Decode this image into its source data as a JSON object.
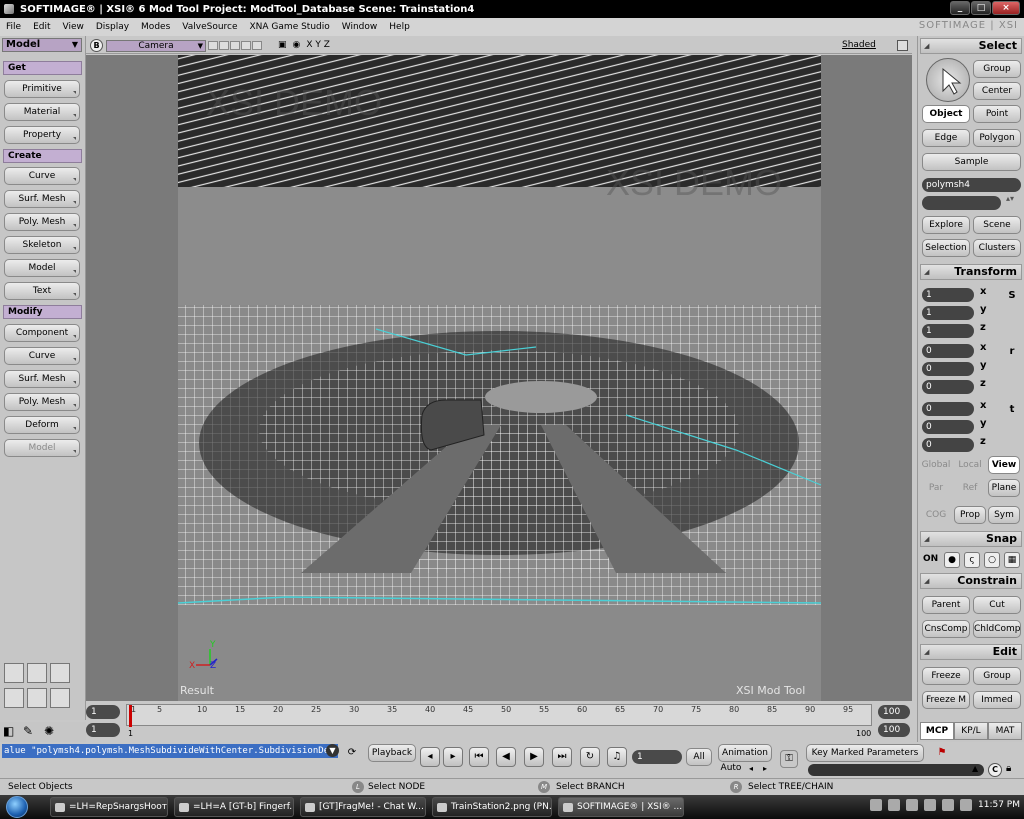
{
  "window": {
    "title": "SOFTIMAGE® | XSI® 6 Mod Tool Project: ModTool_Database    Scene: Trainstation4",
    "brand": "SOFTIMAGE | XSI"
  },
  "menubar": [
    "File",
    "Edit",
    "View",
    "Display",
    "Modes",
    "ValveSource",
    "XNA Game Studio",
    "Window",
    "Help"
  ],
  "left_panel": {
    "mode": "Model",
    "sections": {
      "get": "Get",
      "create": "Create",
      "modify": "Modify"
    },
    "get_buttons": [
      "Primitive",
      "Material",
      "Property"
    ],
    "create_buttons": [
      "Curve",
      "Surf. Mesh",
      "Poly. Mesh",
      "Skeleton",
      "Model",
      "Text"
    ],
    "modify_buttons": [
      "Component",
      "Curve",
      "Surf. Mesh",
      "Poly. Mesh",
      "Deform",
      "Model"
    ]
  },
  "viewport": {
    "b_button": "B",
    "camera": "Camera",
    "axes": "X Y Z",
    "shading": "Shaded",
    "result_label": "Result",
    "brand_label": "XSI Mod Tool",
    "watermark": "XSI DEMO",
    "axis_y": "Y",
    "axis_x": "X",
    "axis_z": "Z"
  },
  "timeline": {
    "start_top": "1",
    "start_bottom": "1",
    "end_top": "100",
    "end_bottom": "100",
    "ticks": [
      "1",
      "5",
      "10",
      "15",
      "20",
      "25",
      "30",
      "35",
      "40",
      "45",
      "50",
      "55",
      "60",
      "65",
      "70",
      "75",
      "80",
      "85",
      "90",
      "95"
    ],
    "bottom_tick_1": "1",
    "bottom_tick_100": "100"
  },
  "command": {
    "text": "alue \"polymsh4.polymsh.MeshSubdivideWithCenter.SubdivisionDepth\", 4",
    "playback": "Playback",
    "frame": "1",
    "all": "All",
    "animation": "Animation",
    "auto": "Auto",
    "key_marked": "Key Marked Parameters"
  },
  "status": {
    "left": "Select Objects",
    "l_mouse": "L",
    "l_text": "Select NODE",
    "m_mouse": "M",
    "m_text": "Select BRANCH",
    "r_mouse": "R",
    "r_text": "Select TREE/CHAIN"
  },
  "right_panel": {
    "select_hdr": "Select",
    "group": "Group",
    "center": "Center",
    "object": "Object",
    "point": "Point",
    "edge": "Edge",
    "polygon": "Polygon",
    "sample": "Sample",
    "selected_name": "polymsh4",
    "explore": "Explore",
    "scene": "Scene",
    "selection": "Selection",
    "clusters": "Clusters",
    "transform_hdr": "Transform",
    "scale": [
      "1",
      "1",
      "1"
    ],
    "rotation": [
      "0",
      "0",
      "0"
    ],
    "translation": [
      "0",
      "0",
      "0"
    ],
    "axis_labels": [
      "x",
      "y",
      "z"
    ],
    "tool_s": "S",
    "tool_r": "r",
    "tool_t": "t",
    "global": "Global",
    "local": "Local",
    "view": "View",
    "par": "Par",
    "ref": "Ref",
    "plane": "Plane",
    "cog": "COG",
    "prop": "Prop",
    "sym": "Sym",
    "snap_hdr": "Snap",
    "snap_on": "ON",
    "constrain_hdr": "Constrain",
    "parent": "Parent",
    "cut": "Cut",
    "cnscomp": "CnsComp",
    "chldcomp": "ChldComp",
    "edit_hdr": "Edit",
    "freeze": "Freeze",
    "edit_group": "Group",
    "freeze_m": "Freeze M",
    "immed": "Immed",
    "tab_mcp": "MCP",
    "tab_kpl": "KP/L",
    "tab_mat": "MAT"
  },
  "taskbar": {
    "tasks": [
      "=LH=RepSнargsHooт...",
      "=LH=A [GT-b] Fingerf...",
      "[GT]FragMe! - Chat W...",
      "TrainStation2.png (PN...",
      "SOFTIMAGE® | XSI® ..."
    ],
    "clock": "11:57 PM"
  }
}
